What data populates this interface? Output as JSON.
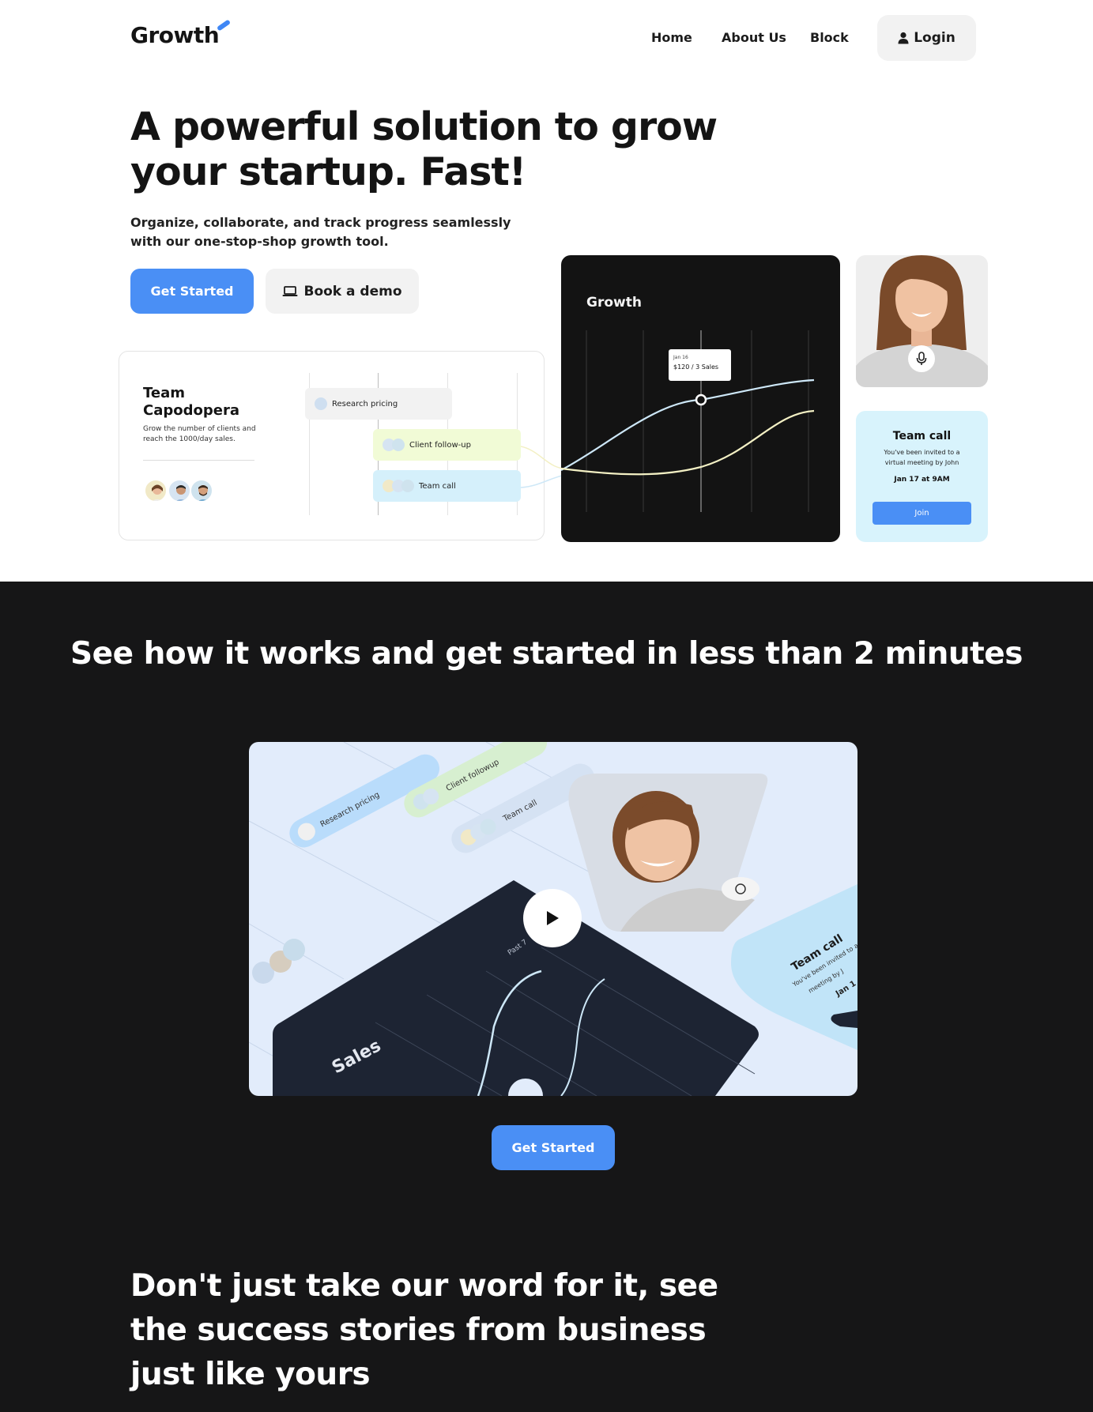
{
  "nav": {
    "logo": "Growth",
    "links": [
      "Home",
      "About Us",
      "Block"
    ],
    "login_label": "Login"
  },
  "hero": {
    "title": "A powerful solution to grow your startup. Fast!",
    "subtitle": "Organize, collaborate, and track progress seamlessly with our one-stop-shop growth tool.",
    "cta_primary": "Get Started",
    "cta_secondary": "Book a demo"
  },
  "team_card": {
    "title": "Team Capodopera",
    "description": "Grow the number of clients and reach the 1000/day sales.",
    "tasks": [
      "Research pricing",
      "Client follow-up",
      "Team call"
    ]
  },
  "chart_card": {
    "title": "Growth",
    "tooltip_date": "Jan 16",
    "tooltip_value": "$120 / 3 Sales"
  },
  "call_card": {
    "title": "Team call",
    "description": "You've been invited to a virtual meeting by John",
    "when": "Jan 17 at 9AM",
    "join_label": "Join"
  },
  "how_it_works": {
    "title": "See how it works and get started in less than 2 minutes",
    "cta": "Get Started",
    "video_labels": {
      "research": "Research pricing",
      "followup": "Client followup",
      "teamcall": "Team call",
      "sales": "Sales",
      "past": "Past 7",
      "call_title": "Team call",
      "call_desc1": "You've been invited to a",
      "call_desc2": "meeting by J",
      "call_date": "Jan 1"
    }
  },
  "testimonials": {
    "title": "Don't just take our word for it, see the success stories from business just like yours"
  },
  "colors": {
    "accent": "#4a8ff5",
    "dark_bg": "#161617",
    "call_card_bg": "#d8f3fc"
  }
}
